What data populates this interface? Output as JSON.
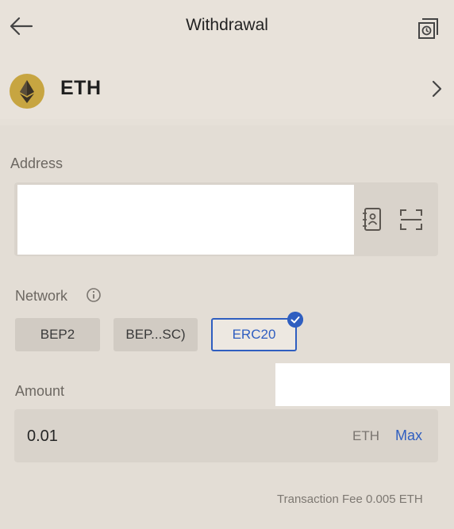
{
  "header": {
    "title": "Withdrawal",
    "back_icon": "arrow-left-icon",
    "history_icon": "history-icon"
  },
  "coin": {
    "symbol": "ETH",
    "logo_icon": "ethereum-icon",
    "logo_color": "#c7a541",
    "chevron_icon": "chevron-right-icon"
  },
  "address": {
    "label": "Address",
    "value": "",
    "addressbook_icon": "address-book-icon",
    "scan_icon": "scan-icon"
  },
  "network": {
    "label": "Network",
    "info_icon": "info-icon",
    "options": [
      {
        "label": "BEP2"
      },
      {
        "label": "BEP...SC)"
      },
      {
        "label": "ERC20"
      }
    ],
    "selected": "ERC20",
    "accent_color": "#2f5ec0"
  },
  "amount": {
    "label": "Amount",
    "value": "0.01",
    "unit": "ETH",
    "max_label": "Max"
  },
  "fee": {
    "text": "Transaction Fee 0.005 ETH"
  }
}
